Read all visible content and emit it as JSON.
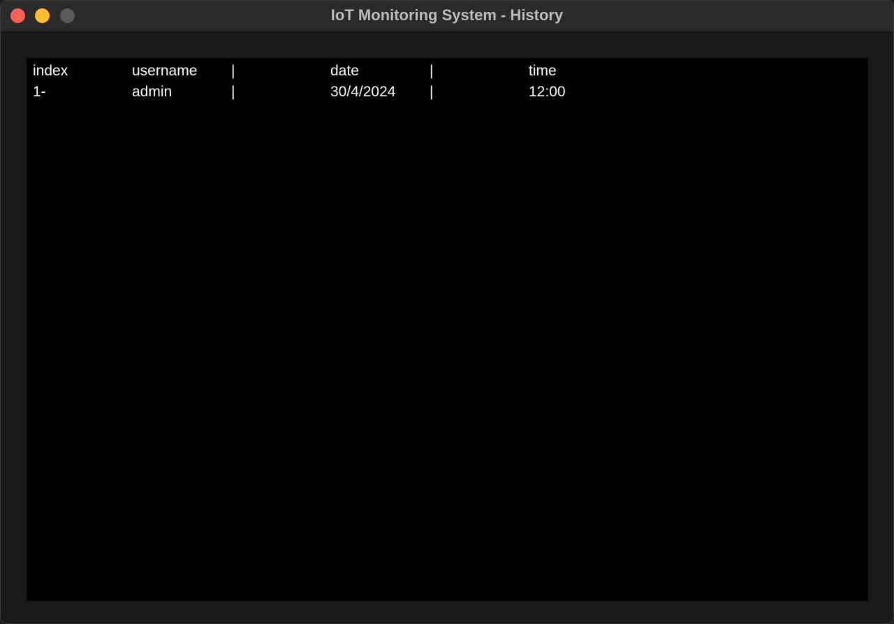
{
  "window": {
    "title": "IoT Monitoring System - History"
  },
  "history": {
    "columns": {
      "index": "index",
      "username": "username",
      "separator1": "|",
      "date": "date",
      "separator2": "|",
      "time": "time"
    },
    "rows": [
      {
        "index": "1-",
        "username": "admin",
        "separator1": "|",
        "date": "30/4/2024",
        "separator2": "|",
        "time": "12:00"
      }
    ]
  },
  "colors": {
    "close": "#fe5f57",
    "minimize": "#febc2e",
    "zoom": "#5a5a5a",
    "list_background": "#000000",
    "text": "#ffffff"
  }
}
